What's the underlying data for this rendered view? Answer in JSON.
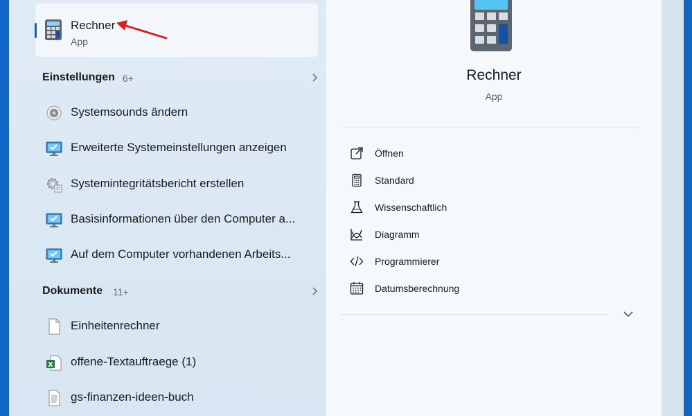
{
  "best_match": {
    "title": "Rechner",
    "subtitle": "App"
  },
  "sections": [
    {
      "name": "Einstellungen",
      "count": "6+",
      "items": [
        {
          "label": "Systemsounds ändern",
          "icon": "speaker-icon"
        },
        {
          "label": "Erweiterte Systemeinstellungen anzeigen",
          "icon": "monitor-check-icon"
        },
        {
          "label": "Systemintegritätsbericht erstellen",
          "icon": "gear-report-icon"
        },
        {
          "label": "Basisinformationen über den Computer a...",
          "icon": "monitor-check-icon"
        },
        {
          "label": "Auf dem Computer vorhandenen Arbeits...",
          "icon": "monitor-check-icon"
        }
      ]
    },
    {
      "name": "Dokumente",
      "count": "11+",
      "items": [
        {
          "label": "Einheitenrechner",
          "icon": "document-icon"
        },
        {
          "label": "offene-Textauftraege (1)",
          "icon": "excel-file-icon"
        },
        {
          "label": "gs-finanzen-ideen-buch",
          "icon": "text-file-icon"
        }
      ]
    }
  ],
  "detail": {
    "title": "Rechner",
    "subtitle": "App",
    "actions": [
      {
        "label": "Öffnen",
        "icon": "open-external-icon"
      },
      {
        "label": "Standard",
        "icon": "calculator-icon"
      },
      {
        "label": "Wissenschaftlich",
        "icon": "flask-icon"
      },
      {
        "label": "Diagramm",
        "icon": "graph-icon"
      },
      {
        "label": "Programmierer",
        "icon": "code-icon"
      },
      {
        "label": "Datumsberechnung",
        "icon": "calendar-icon"
      }
    ]
  },
  "colors": {
    "accent": "#1c5fb0",
    "desktop": "#1466c4",
    "arrow": "#d92020"
  }
}
